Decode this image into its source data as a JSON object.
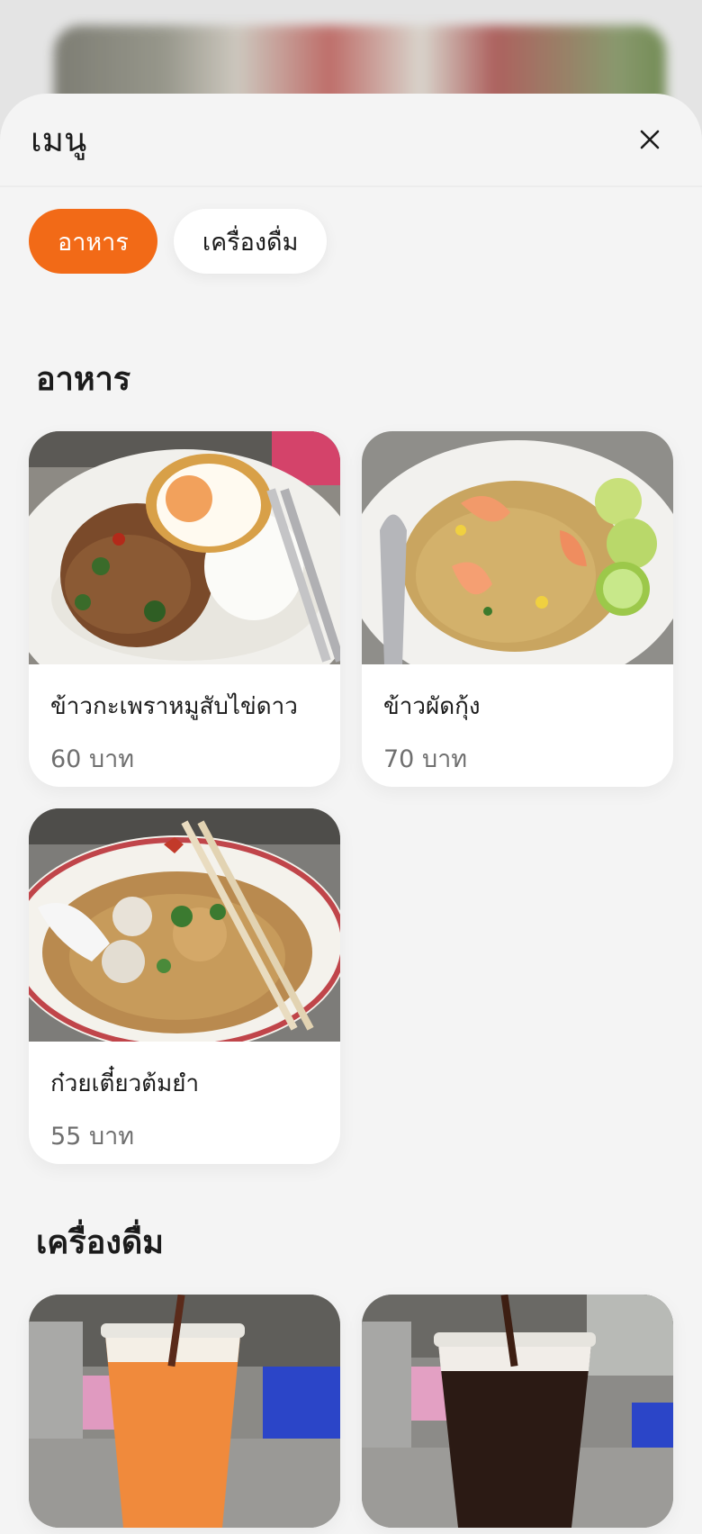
{
  "sheet": {
    "title": "เมนู"
  },
  "tabs": [
    {
      "label": "อาหาร",
      "active": true
    },
    {
      "label": "เครื่องดื่ม",
      "active": false
    }
  ],
  "sections": [
    {
      "title": "อาหาร",
      "items": [
        {
          "name": "ข้าวกะเพราหมูสับไข่ดาว",
          "price": "60 บาท"
        },
        {
          "name": "ข้าวผัดกุ้ง",
          "price": "70 บาท"
        },
        {
          "name": "ก๋วยเตี๋ยวต้มยำ",
          "price": "55 บาท"
        }
      ]
    },
    {
      "title": "เครื่องดื่ม",
      "items": []
    }
  ],
  "colors": {
    "accent": "#f26a17",
    "background": "#f4f4f4",
    "card": "#ffffff"
  },
  "icons": {
    "close": "close-icon"
  }
}
